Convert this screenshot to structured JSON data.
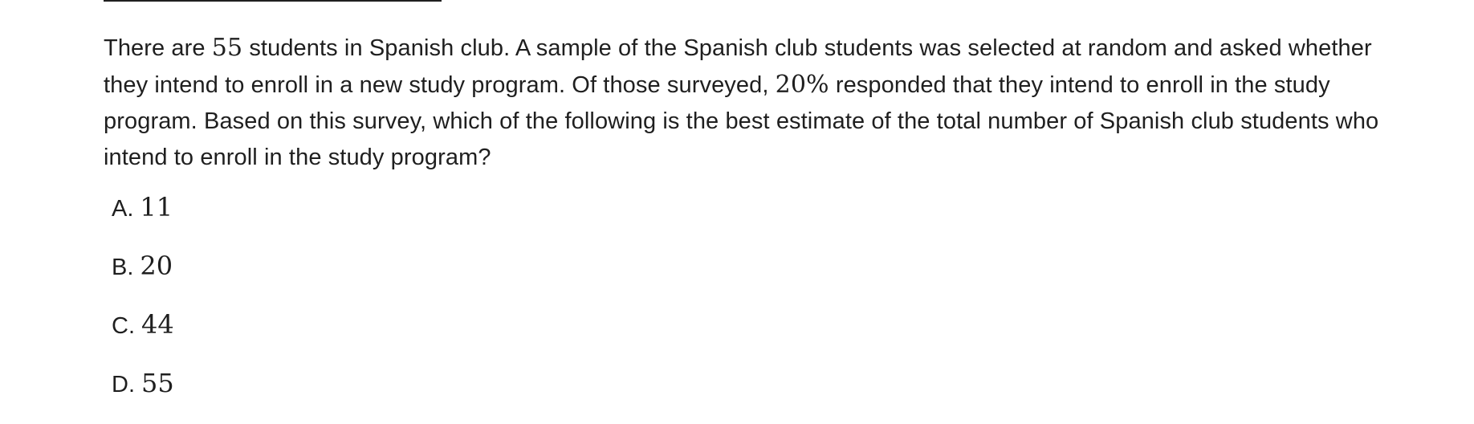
{
  "question": {
    "part1": "There are ",
    "total": "55",
    "part2": " students in Spanish club. A sample of the Spanish club students was selected at random and asked whether they intend to enroll in a new study program. Of those surveyed, ",
    "percent": "20%",
    "part3": " responded that they intend to enroll in the study program. Based on this survey, which of the following is the best estimate of the total number of Spanish club students who intend to enroll in the study program?"
  },
  "choices": [
    {
      "letter": "A.",
      "value": "11"
    },
    {
      "letter": "B.",
      "value": "20"
    },
    {
      "letter": "C.",
      "value": "44"
    },
    {
      "letter": "D.",
      "value": "55"
    }
  ]
}
